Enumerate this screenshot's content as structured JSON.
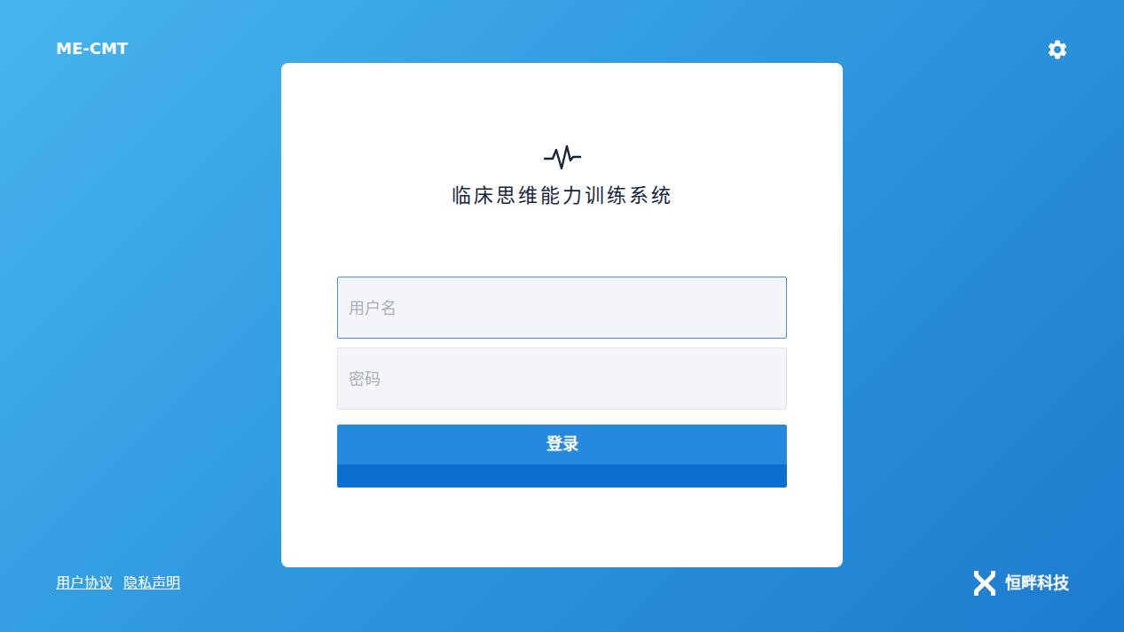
{
  "app": {
    "code": "ME-CMT",
    "title": "临床思维能力训练系统"
  },
  "form": {
    "username": {
      "placeholder": "用户名",
      "focused": true
    },
    "password": {
      "placeholder": "密码",
      "focused": false
    },
    "submit": "登录"
  },
  "footer": {
    "links": [
      "用户协议",
      "隐私声明"
    ],
    "company": "恒畔科技"
  }
}
